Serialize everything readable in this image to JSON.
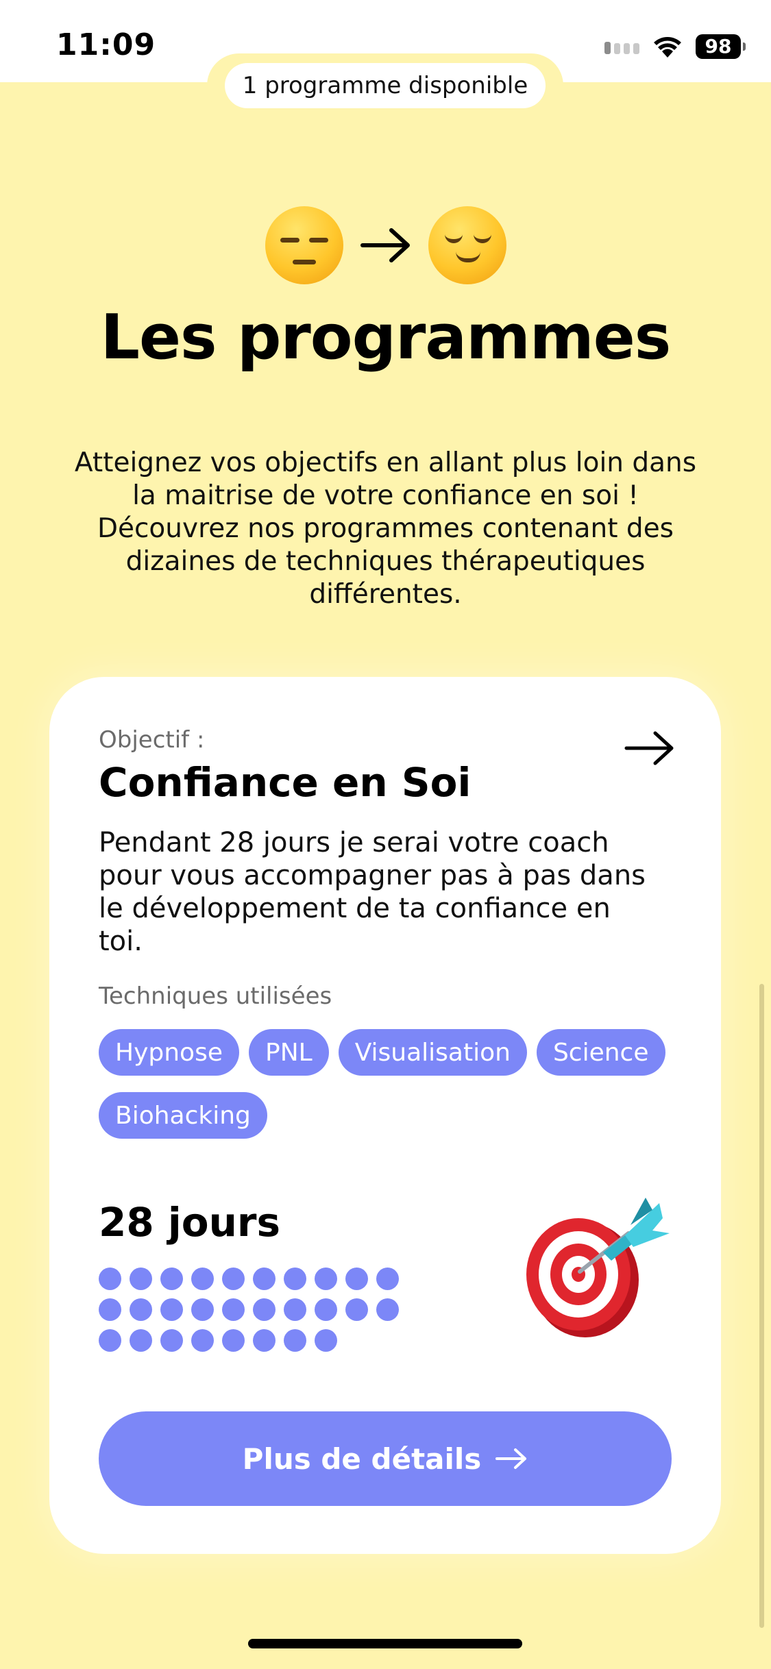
{
  "status_bar": {
    "time": "11:09",
    "battery": "98",
    "icons": [
      "signal-icon",
      "wifi-icon",
      "battery-icon"
    ]
  },
  "header": {
    "available_count": "1 programme disponible",
    "emojis": [
      "expressionless-face-icon",
      "arrow-right-icon",
      "relieved-face-icon"
    ],
    "title": "Les programmes",
    "description": "Atteignez vos objectifs en allant plus loin dans la maitrise de votre confiance en soi ! Découvrez nos programmes contenant des dizaines de techniques thérapeutiques différentes."
  },
  "program_card": {
    "objective_label": "Objectif :",
    "title": "Confiance en Soi",
    "description": "Pendant 28 jours je serai votre coach pour vous accompagner pas à pas dans le développement de ta confiance en toi.",
    "techniques_label": "Techniques utilisées",
    "tags": [
      "Hypnose",
      "PNL",
      "Visualisation",
      "Science",
      "Biohacking"
    ],
    "duration": "28 jours",
    "day_count": 28,
    "illustration": "target-dart-icon",
    "cta_label": "Plus de détails"
  },
  "colors": {
    "background": "#FEF4AE",
    "accent": "#7C87F7",
    "card": "#FFFFFF"
  }
}
